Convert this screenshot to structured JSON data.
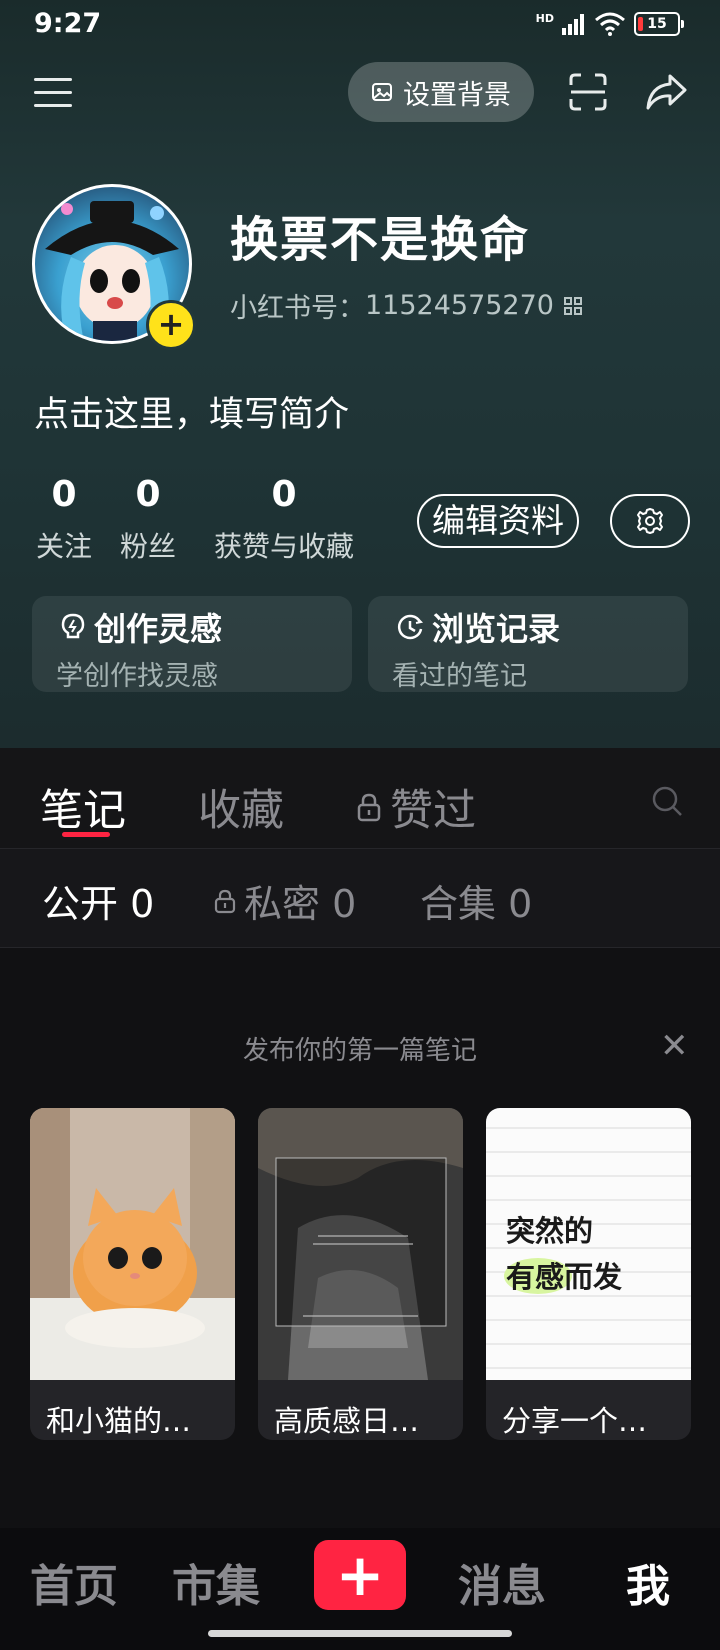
{
  "status_bar": {
    "time": "9:27",
    "network": "HD",
    "battery": "15"
  },
  "header": {
    "set_background_label": "设置背景"
  },
  "profile": {
    "nickname": "换票不是换命",
    "id_label": "小红书号：",
    "id_value": "11524575270",
    "bio": "点击这里，填写简介"
  },
  "stats": [
    {
      "value": "0",
      "label": "关注"
    },
    {
      "value": "0",
      "label": "粉丝"
    },
    {
      "value": "0",
      "label": "获赞与收藏"
    }
  ],
  "edit_profile_label": "编辑资料",
  "quick_cards": [
    {
      "title": "创作灵感",
      "subtitle": "学创作找灵感",
      "icon": "bulb-icon"
    },
    {
      "title": "浏览记录",
      "subtitle": "看过的笔记",
      "icon": "clock-icon"
    }
  ],
  "tabs": [
    {
      "label": "笔记",
      "active": true
    },
    {
      "label": "收藏",
      "active": false
    },
    {
      "label": "赞过",
      "active": false,
      "locked": true
    }
  ],
  "subtabs": [
    {
      "label": "公开 0",
      "active": true
    },
    {
      "label": "私密 0",
      "active": false,
      "locked": true
    },
    {
      "label": "合集 0",
      "active": false
    }
  ],
  "publish": {
    "title": "发布你的第一篇笔记",
    "templates": [
      {
        "caption": "和小猫的…",
        "theme": "cat"
      },
      {
        "caption": "高质感日…",
        "theme": "dark-photo"
      },
      {
        "caption": "分享一个…",
        "theme": "note-paper",
        "art_text_1": "突然的",
        "art_text_2_a": "有感",
        "art_text_2_b": "而发"
      }
    ]
  },
  "bottom_nav": [
    {
      "label": "首页",
      "active": false
    },
    {
      "label": "市集",
      "active": false
    },
    {
      "label": "消息",
      "active": false
    },
    {
      "label": "我",
      "active": true
    }
  ],
  "colors": {
    "accent": "#ff2442",
    "avatar_badge": "#ffe21a",
    "header_bg": "#22383a",
    "page_bg": "#111113"
  }
}
